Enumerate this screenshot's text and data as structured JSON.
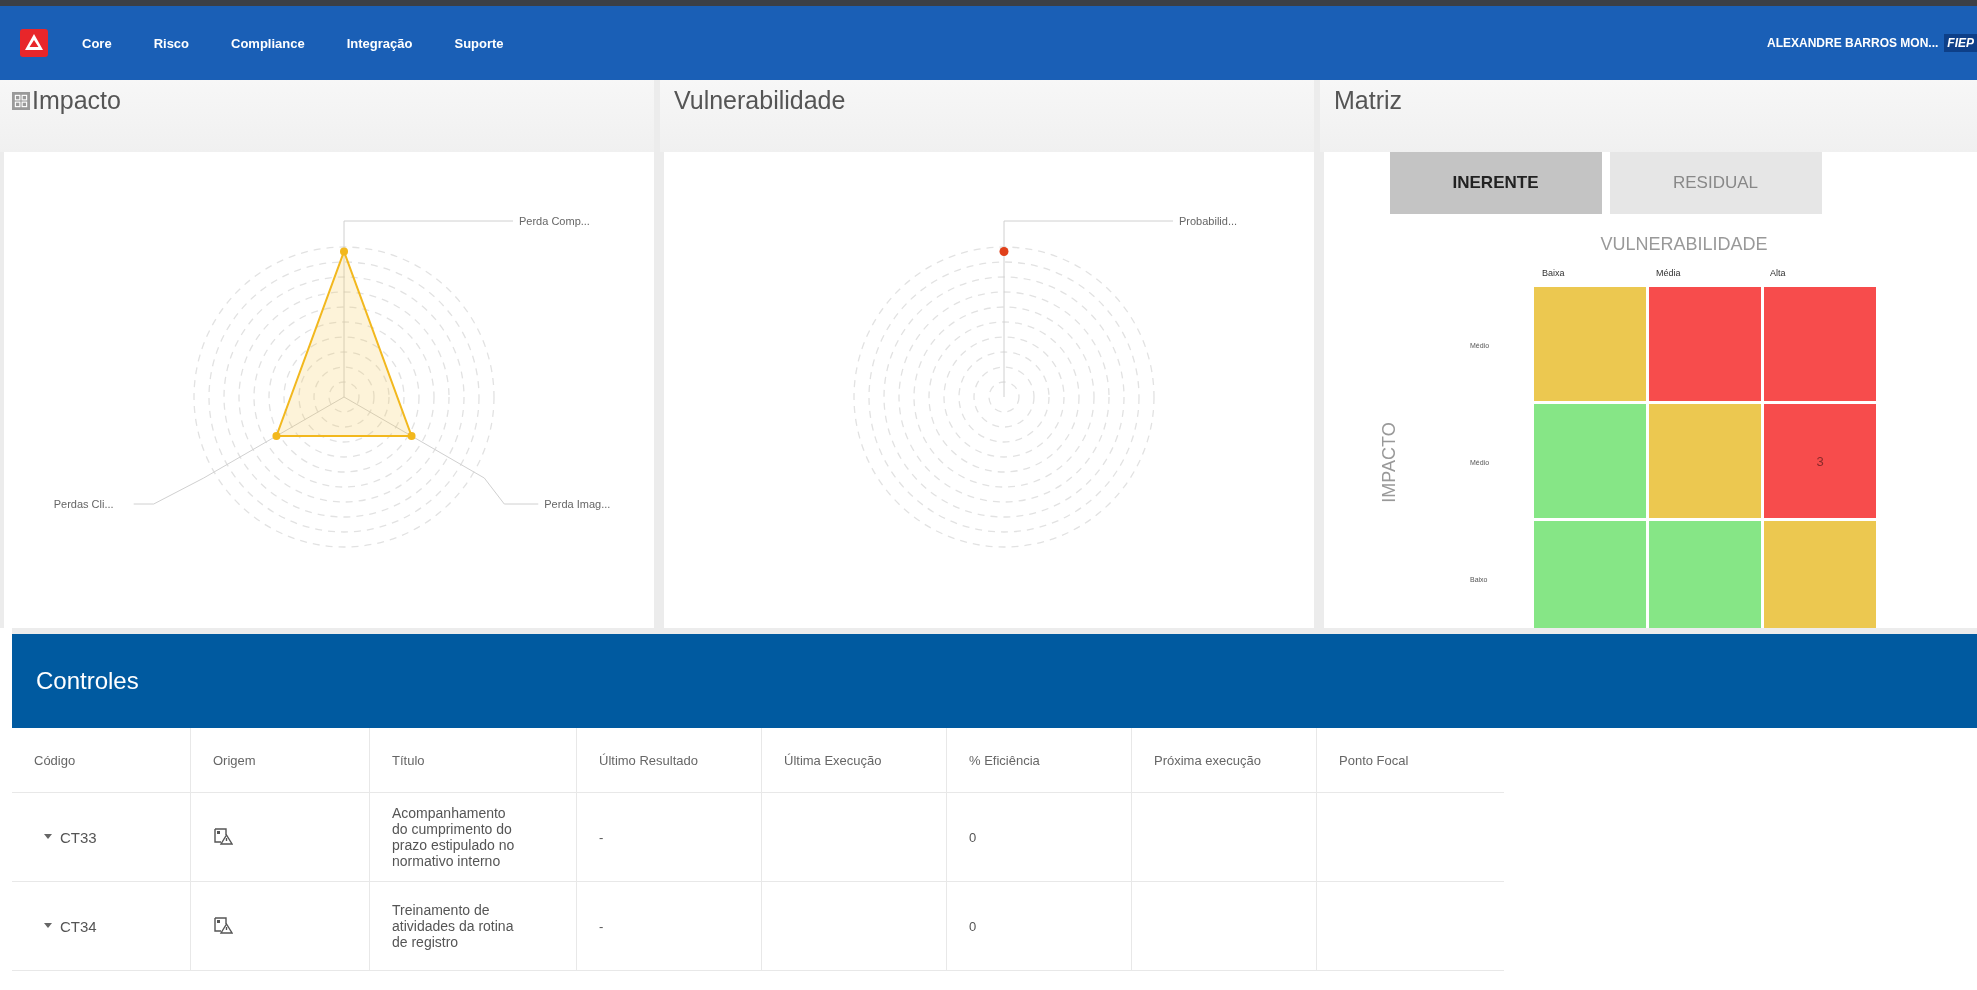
{
  "nav": {
    "items": [
      {
        "label": "Core"
      },
      {
        "label": "Risco"
      },
      {
        "label": "Compliance"
      },
      {
        "label": "Integração"
      },
      {
        "label": "Suporte"
      }
    ],
    "user": "ALEXANDRE BARROS MON...",
    "org_badge": "FIEP"
  },
  "panels": [
    {
      "kind": "radar",
      "title": "Impacto",
      "axes": [
        "Perda Comp...",
        "Perda Imag...",
        "Perdas Cli..."
      ]
    },
    {
      "kind": "radar",
      "title": "Vulnerabilidade",
      "axes": [
        "Probabilid..."
      ]
    },
    {
      "kind": "matrix",
      "title": "Matriz",
      "tabs": [
        {
          "label": "INERENTE",
          "selected": true
        },
        {
          "label": "RESIDUAL",
          "selected": false
        }
      ],
      "x_title": "VULNERABILIDADE",
      "y_title": "IMPACTO",
      "columns": [
        "Baixa",
        "Média",
        "Alta"
      ],
      "rows": [
        {
          "label": "Médio",
          "cells": [
            {
              "color": "#ecc850"
            },
            {
              "color": "#f74c4c"
            },
            {
              "color": "#f74c4c"
            }
          ]
        },
        {
          "label": "Médio",
          "cells": [
            {
              "color": "#86e686"
            },
            {
              "color": "#ecc850"
            },
            {
              "color": "#f74c4c",
              "text": "3"
            }
          ]
        },
        {
          "label": "Baixo",
          "cells": [
            {
              "color": "#86e686"
            },
            {
              "color": "#86e686"
            },
            {
              "color": "#ecc850"
            }
          ]
        }
      ]
    }
  ],
  "controls": {
    "title": "Controles",
    "columns": [
      "Código",
      "Origem",
      "Título",
      "Último Resultado",
      "Última Execução",
      "% Eficiência",
      "Próxima execução",
      "Ponto Focal"
    ],
    "rows": [
      {
        "code": "CT33",
        "title": "Acompanhamento do cumprimento do prazo estipulado no normativo interno",
        "last_result": "-",
        "efficiency": "0"
      },
      {
        "code": "CT34",
        "title": "Treinamento de atividades da rotina de registro",
        "last_result": "-",
        "efficiency": "0"
      }
    ]
  }
}
